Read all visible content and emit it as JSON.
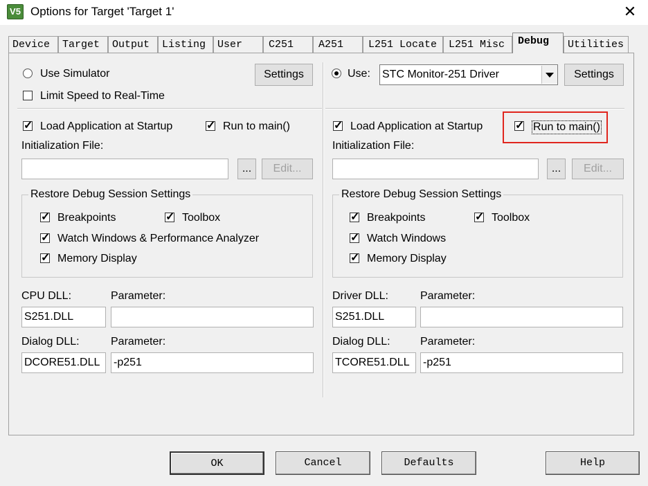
{
  "window": {
    "title": "Options for Target 'Target 1'",
    "app_icon_text": "V5",
    "close_glyph": "✕"
  },
  "tabs": [
    {
      "label": "Device"
    },
    {
      "label": "Target"
    },
    {
      "label": "Output"
    },
    {
      "label": "Listing"
    },
    {
      "label": "User"
    },
    {
      "label": "C251"
    },
    {
      "label": "A251"
    },
    {
      "label": "L251 Locate"
    },
    {
      "label": "L251 Misc"
    },
    {
      "label": "Debug",
      "active": true
    },
    {
      "label": "Utilities"
    }
  ],
  "left": {
    "use_simulator": {
      "label": "Use Simulator",
      "selected": false
    },
    "settings_label": "Settings",
    "limit_speed": {
      "label": "Limit Speed to Real-Time",
      "checked": false
    },
    "load_app": {
      "label": "Load Application at Startup",
      "checked": true
    },
    "run_to_main": {
      "label": "Run to main()",
      "checked": true
    },
    "init_file_label": "Initialization File:",
    "init_file_value": "",
    "browse_label": "...",
    "edit_label": "Edit...",
    "restore_title": "Restore Debug Session Settings",
    "breakpoints": {
      "label": "Breakpoints",
      "checked": true
    },
    "toolbox": {
      "label": "Toolbox",
      "checked": true
    },
    "watch": {
      "label": "Watch Windows & Performance Analyzer",
      "checked": true
    },
    "memory": {
      "label": "Memory Display",
      "checked": true
    },
    "dll1_label": "CPU DLL:",
    "dll1_value": "S251.DLL",
    "param_label": "Parameter:",
    "param1_value": "",
    "dll2_label": "Dialog DLL:",
    "dll2_value": "DCORE51.DLL",
    "param2_value": "-p251"
  },
  "right": {
    "use": {
      "label": "Use:",
      "selected": true
    },
    "driver_value": "STC Monitor-251 Driver",
    "settings_label": "Settings",
    "load_app": {
      "label": "Load Application at Startup",
      "checked": true
    },
    "run_to_main": {
      "label": "Run to main()",
      "checked": true
    },
    "init_file_label": "Initialization File:",
    "init_file_value": "",
    "browse_label": "...",
    "edit_label": "Edit...",
    "restore_title": "Restore Debug Session Settings",
    "breakpoints": {
      "label": "Breakpoints",
      "checked": true
    },
    "toolbox": {
      "label": "Toolbox",
      "checked": true
    },
    "watch": {
      "label": "Watch Windows",
      "checked": true
    },
    "memory": {
      "label": "Memory Display",
      "checked": true
    },
    "dll1_label": "Driver DLL:",
    "dll1_value": "S251.DLL",
    "param_label": "Parameter:",
    "param1_value": "",
    "dll2_label": "Dialog DLL:",
    "dll2_value": "TCORE51.DLL",
    "param2_value": "-p251"
  },
  "buttons": {
    "ok": "OK",
    "cancel": "Cancel",
    "defaults": "Defaults",
    "help": "Help"
  },
  "colors": {
    "highlight_box": "#e0261e"
  }
}
